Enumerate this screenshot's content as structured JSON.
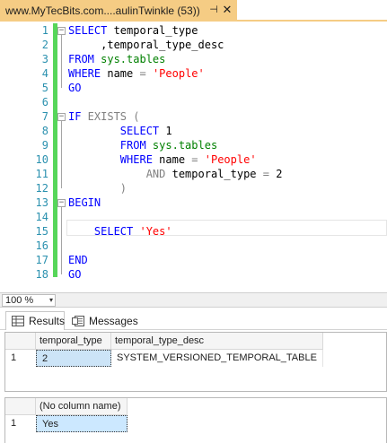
{
  "tab": {
    "title": "www.MyTecBits.com....aulinTwinkle (53))",
    "pin_glyph": "⊣",
    "close_glyph": "✕"
  },
  "editor": {
    "line_numbers": [
      "1",
      "2",
      "3",
      "4",
      "5",
      "6",
      "7",
      "8",
      "9",
      "10",
      "11",
      "12",
      "13",
      "14",
      "15",
      "16",
      "17",
      "18"
    ],
    "lines": [
      [
        {
          "t": "SELECT",
          "c": "kw"
        },
        {
          "t": " temporal_type",
          "c": ""
        }
      ],
      [
        {
          "t": "     ,temporal_type_desc",
          "c": ""
        }
      ],
      [
        {
          "t": "FROM",
          "c": "kw"
        },
        {
          "t": " sys.tables",
          "c": "sys"
        }
      ],
      [
        {
          "t": "WHERE",
          "c": "kw"
        },
        {
          "t": " name ",
          "c": ""
        },
        {
          "t": "=",
          "c": "gray"
        },
        {
          "t": " 'People'",
          "c": "str"
        }
      ],
      [
        {
          "t": "GO",
          "c": "kw"
        }
      ],
      [],
      [
        {
          "t": "IF",
          "c": "kw"
        },
        {
          "t": " EXISTS ",
          "c": "gray"
        },
        {
          "t": "(",
          "c": "gray"
        }
      ],
      [
        {
          "t": "        SELECT",
          "c": "kw"
        },
        {
          "t": " 1",
          "c": ""
        }
      ],
      [
        {
          "t": "        FROM",
          "c": "kw"
        },
        {
          "t": " sys.tables",
          "c": "sys"
        }
      ],
      [
        {
          "t": "        WHERE",
          "c": "kw"
        },
        {
          "t": " name ",
          "c": ""
        },
        {
          "t": "=",
          "c": "gray"
        },
        {
          "t": " 'People'",
          "c": "str"
        }
      ],
      [
        {
          "t": "            AND",
          "c": "gray"
        },
        {
          "t": " temporal_type ",
          "c": ""
        },
        {
          "t": "=",
          "c": "gray"
        },
        {
          "t": " 2",
          "c": ""
        }
      ],
      [
        {
          "t": "        )",
          "c": "gray"
        }
      ],
      [
        {
          "t": "BEGIN",
          "c": "kw"
        }
      ],
      [],
      [
        {
          "t": "    SELECT",
          "c": "kw"
        },
        {
          "t": " 'Yes'",
          "c": "str"
        }
      ],
      [],
      [
        {
          "t": "END",
          "c": "kw"
        }
      ],
      [
        {
          "t": "GO",
          "c": "kw"
        }
      ]
    ]
  },
  "zoom": {
    "value": "100 %",
    "arrow": "▾"
  },
  "result_tabs": {
    "results_label": "Results",
    "messages_label": "Messages"
  },
  "grid1": {
    "columns": [
      "temporal_type",
      "temporal_type_desc"
    ],
    "rows": [
      {
        "num": "1",
        "values": [
          "2",
          "SYSTEM_VERSIONED_TEMPORAL_TABLE"
        ]
      }
    ]
  },
  "grid2": {
    "columns": [
      "(No column name)"
    ],
    "rows": [
      {
        "num": "1",
        "values": [
          "Yes"
        ]
      }
    ]
  },
  "colors": {
    "tab_bg": "#f5cc84",
    "keyword": "#0000ff",
    "string": "#ff0000",
    "system_object": "#008000",
    "line_number": "#2b91af",
    "change_bar": "#57d65a"
  }
}
